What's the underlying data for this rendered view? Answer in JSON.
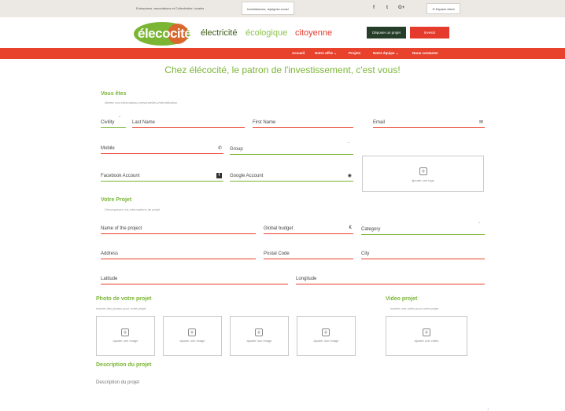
{
  "topbar": {
    "left_text": "Entreprises, associations et Collectivités Locales",
    "investor_label": "Investisseurs, rejoignez-nous!",
    "social": [
      "f",
      "t",
      "G+"
    ],
    "client_label": "Espace client"
  },
  "header": {
    "logo_text": "élecocité",
    "tagline1": "électricité",
    "tagline2": "écologique",
    "tagline3": "citoyenne",
    "deposit_label": "Déposer un projet",
    "invest_label": "Investir"
  },
  "nav": {
    "items": [
      "Accueil",
      "Notre offre ⌄",
      "Projets",
      "Notre équipe ⌄",
      "Nous contacter"
    ]
  },
  "headline": "Chez élécocité, le patron de l'investissement, c'est vous!",
  "vous_etes": {
    "title": "Vous êtes",
    "subtitle": "Mettez vos informations personnelles d'identification",
    "civility": "Civility",
    "last_name": "Last Name",
    "first_name": "First Name",
    "email": "Email",
    "mobile": "Mobile",
    "group": "Group",
    "facebook": "Facebook Account",
    "google": "Google Account",
    "logo_label": "ajouter une logo"
  },
  "projet": {
    "title": "Votre Projet",
    "subtitle": "Décomposez vos informations de projet",
    "name": "Name of the project",
    "budget": "Global budget",
    "currency": "€",
    "category": "Category",
    "address": "Address",
    "postal": "Postal Code",
    "city": "City",
    "latitude": "Latitude",
    "longitude": "Longitude"
  },
  "photos": {
    "title": "Photo de votre projet",
    "subtitle": "Insérer des photos pour votre projet",
    "box_label": "ajouter une image"
  },
  "video": {
    "title": "Video projet",
    "subtitle": "Insérer une vidéo pour votre projet",
    "box_label": "ajouter une vidéo"
  },
  "description": {
    "title": "Description du projet",
    "placeholder": "Description du projet"
  },
  "colors": {
    "accent_green": "#7ab534",
    "accent_red": "#e8412c",
    "dark_green": "#263d2a"
  }
}
